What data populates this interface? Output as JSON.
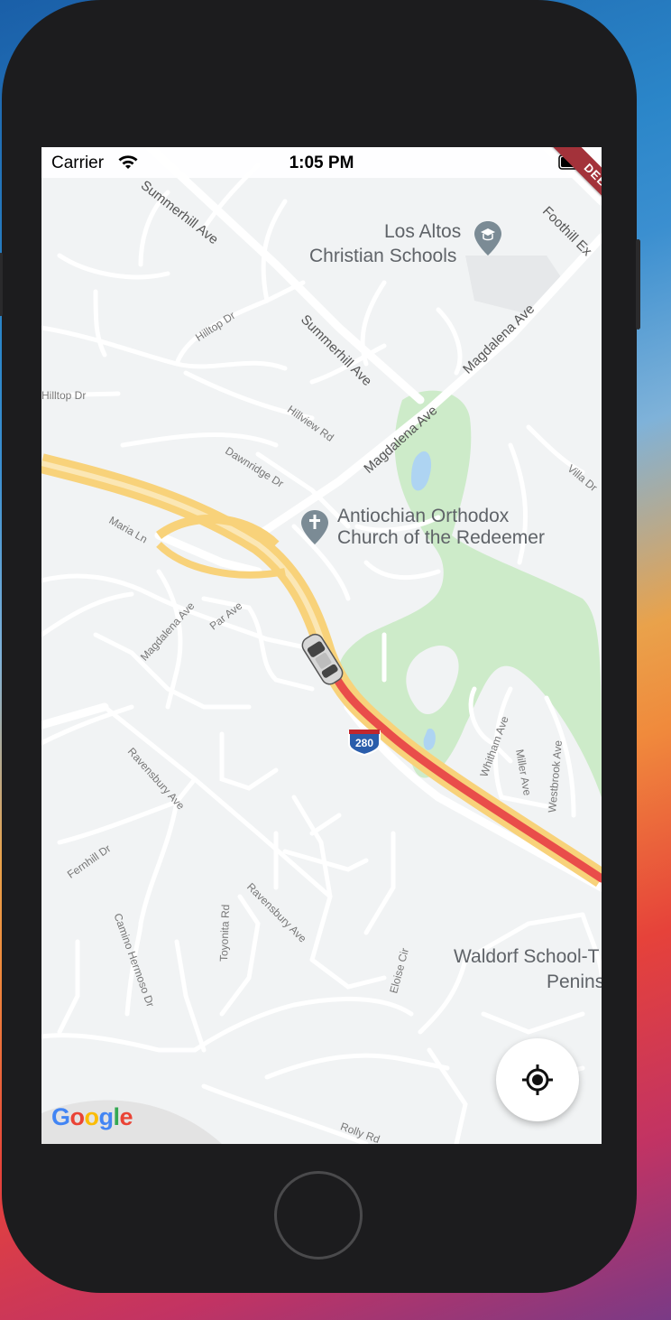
{
  "status": {
    "carrier": "Carrier",
    "time": "1:05 PM"
  },
  "debug_banner": "DEBUG",
  "pois": {
    "school_top_1": "Los Altos",
    "school_top_2": "Christian Schools",
    "church_1": "Antiochian Orthodox",
    "church_2": "Church of the Redeemer",
    "waldorf_1": "Waldorf School-T",
    "waldorf_2": "Penins"
  },
  "streets": {
    "summerhill_top": "Summerhill Ave",
    "summerhill_mid": "Summerhill Ave",
    "foothill": "Foothill Ex",
    "hilltop_1": "Hilltop Dr",
    "hilltop_2": "Hilltop Dr",
    "magdalena_1": "Magdalena Ave",
    "magdalena_2": "Magdalena Ave",
    "magdalena_3": "Magdalena Ave",
    "hillview": "Hillview Rd",
    "dawnridge": "Dawnridge Dr",
    "villa": "Villa Dr",
    "maria": "Maria Ln",
    "par": "Par Ave",
    "ravensbury_1": "Ravensbury Ave",
    "ravensbury_2": "Ravensbury Ave",
    "whitham": "Whitham Ave",
    "miller": "Miller Ave",
    "westbrook": "Westbrook Ave",
    "fernhill": "Fernhill Dr",
    "camino": "Camino Hermoso Dr",
    "toyonita": "Toyonita Rd",
    "eloise": "Eloise Cir",
    "rolly": "Rolly Rd"
  },
  "highway_shield": "280",
  "google_logo": {
    "letters": [
      "G",
      "o",
      "o",
      "g",
      "l",
      "e"
    ],
    "colors": [
      "#4285f4",
      "#ea4335",
      "#fbbc05",
      "#4285f4",
      "#34a853",
      "#ea4335"
    ]
  },
  "colors": {
    "traffic": "#e94d4a",
    "highway": "#f8d27a",
    "park": "#cdebc9",
    "water": "#aed4f2"
  }
}
